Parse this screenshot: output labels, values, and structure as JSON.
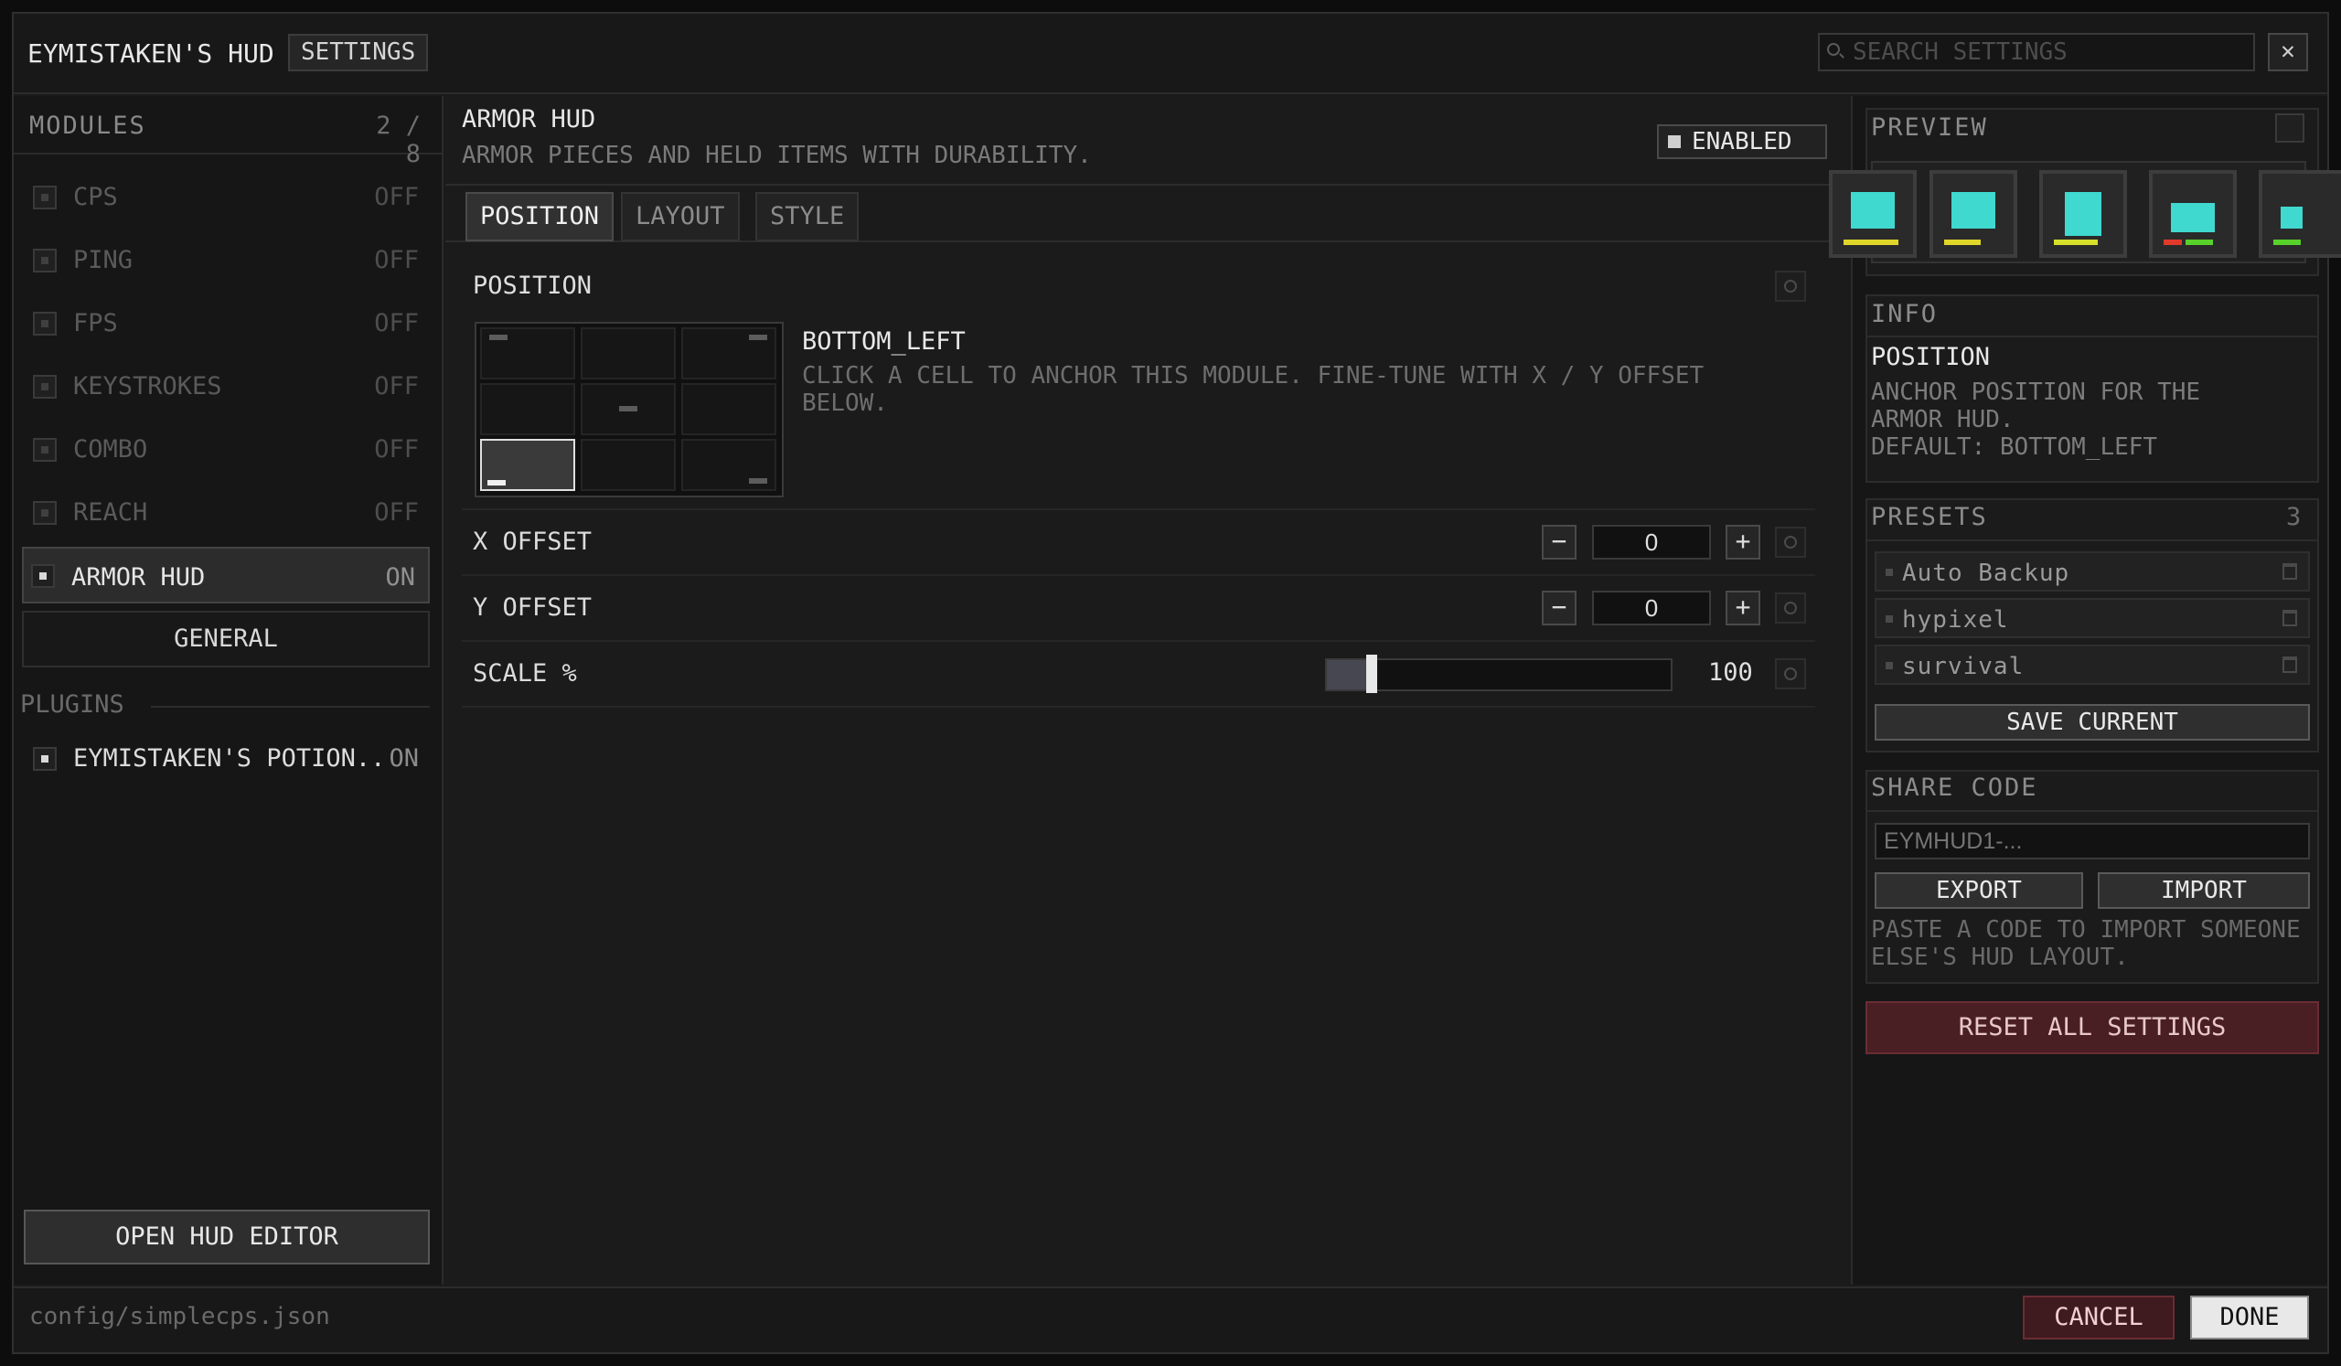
{
  "window": {
    "title": "EYMISTAKEN'S HUD",
    "tag": "SETTINGS",
    "search_placeholder": "SEARCH SETTINGS",
    "close": "✕"
  },
  "sidebar": {
    "modules_title": "MODULES",
    "modules_count": "2 / 8",
    "items": [
      {
        "label": "CPS",
        "state": "OFF"
      },
      {
        "label": "PING",
        "state": "OFF"
      },
      {
        "label": "FPS",
        "state": "OFF"
      },
      {
        "label": "KEYSTROKES",
        "state": "OFF"
      },
      {
        "label": "COMBO",
        "state": "OFF"
      },
      {
        "label": "REACH",
        "state": "OFF"
      },
      {
        "label": "ARMOR HUD",
        "state": "ON"
      }
    ],
    "general": "GENERAL",
    "plugins_title": "PLUGINS",
    "plugins": [
      {
        "label": "EYMISTAKEN'S POTION..",
        "state": "ON"
      }
    ],
    "open_editor": "OPEN HUD EDITOR"
  },
  "module": {
    "name": "ARMOR HUD",
    "description": "ARMOR PIECES AND HELD ITEMS WITH DURABILITY.",
    "enabled_label": "ENABLED",
    "tabs": [
      "POSITION",
      "LAYOUT",
      "STYLE"
    ],
    "active_tab": "POSITION"
  },
  "position": {
    "section_title": "POSITION",
    "anchor_value": "BOTTOM_LEFT",
    "anchor_help": "CLICK A CELL TO ANCHOR THIS MODULE. FINE-TUNE WITH X / Y OFFSET BELOW.",
    "x_offset_label": "X OFFSET",
    "x_offset_value": "0",
    "y_offset_label": "Y OFFSET",
    "y_offset_value": "0",
    "scale_label": "SCALE %",
    "scale_value": "100",
    "scale_fill_fraction": 0.12,
    "minus": "−",
    "plus": "+"
  },
  "preview": {
    "title": "PREVIEW",
    "armor_color": "#3fd9d0"
  },
  "info": {
    "title": "INFO",
    "heading": "POSITION",
    "text": "ANCHOR POSITION FOR THE ARMOR HUD.",
    "default": "DEFAULT: BOTTOM_LEFT"
  },
  "presets": {
    "title": "PRESETS",
    "count": "3",
    "items": [
      "Auto Backup",
      "hypixel",
      "survival"
    ],
    "save_current": "SAVE CURRENT"
  },
  "share": {
    "title": "SHARE CODE",
    "placeholder": "EYMHUD1-...",
    "export": "EXPORT",
    "import": "IMPORT",
    "help": "PASTE A CODE TO IMPORT SOMEONE ELSE'S HUD LAYOUT."
  },
  "reset_all": "RESET ALL SETTINGS",
  "footer": {
    "path": "config/simplecps.json",
    "cancel": "CANCEL",
    "done": "DONE"
  },
  "colors": {
    "danger": "#4a1f24",
    "accent": "#3fd9d0"
  }
}
